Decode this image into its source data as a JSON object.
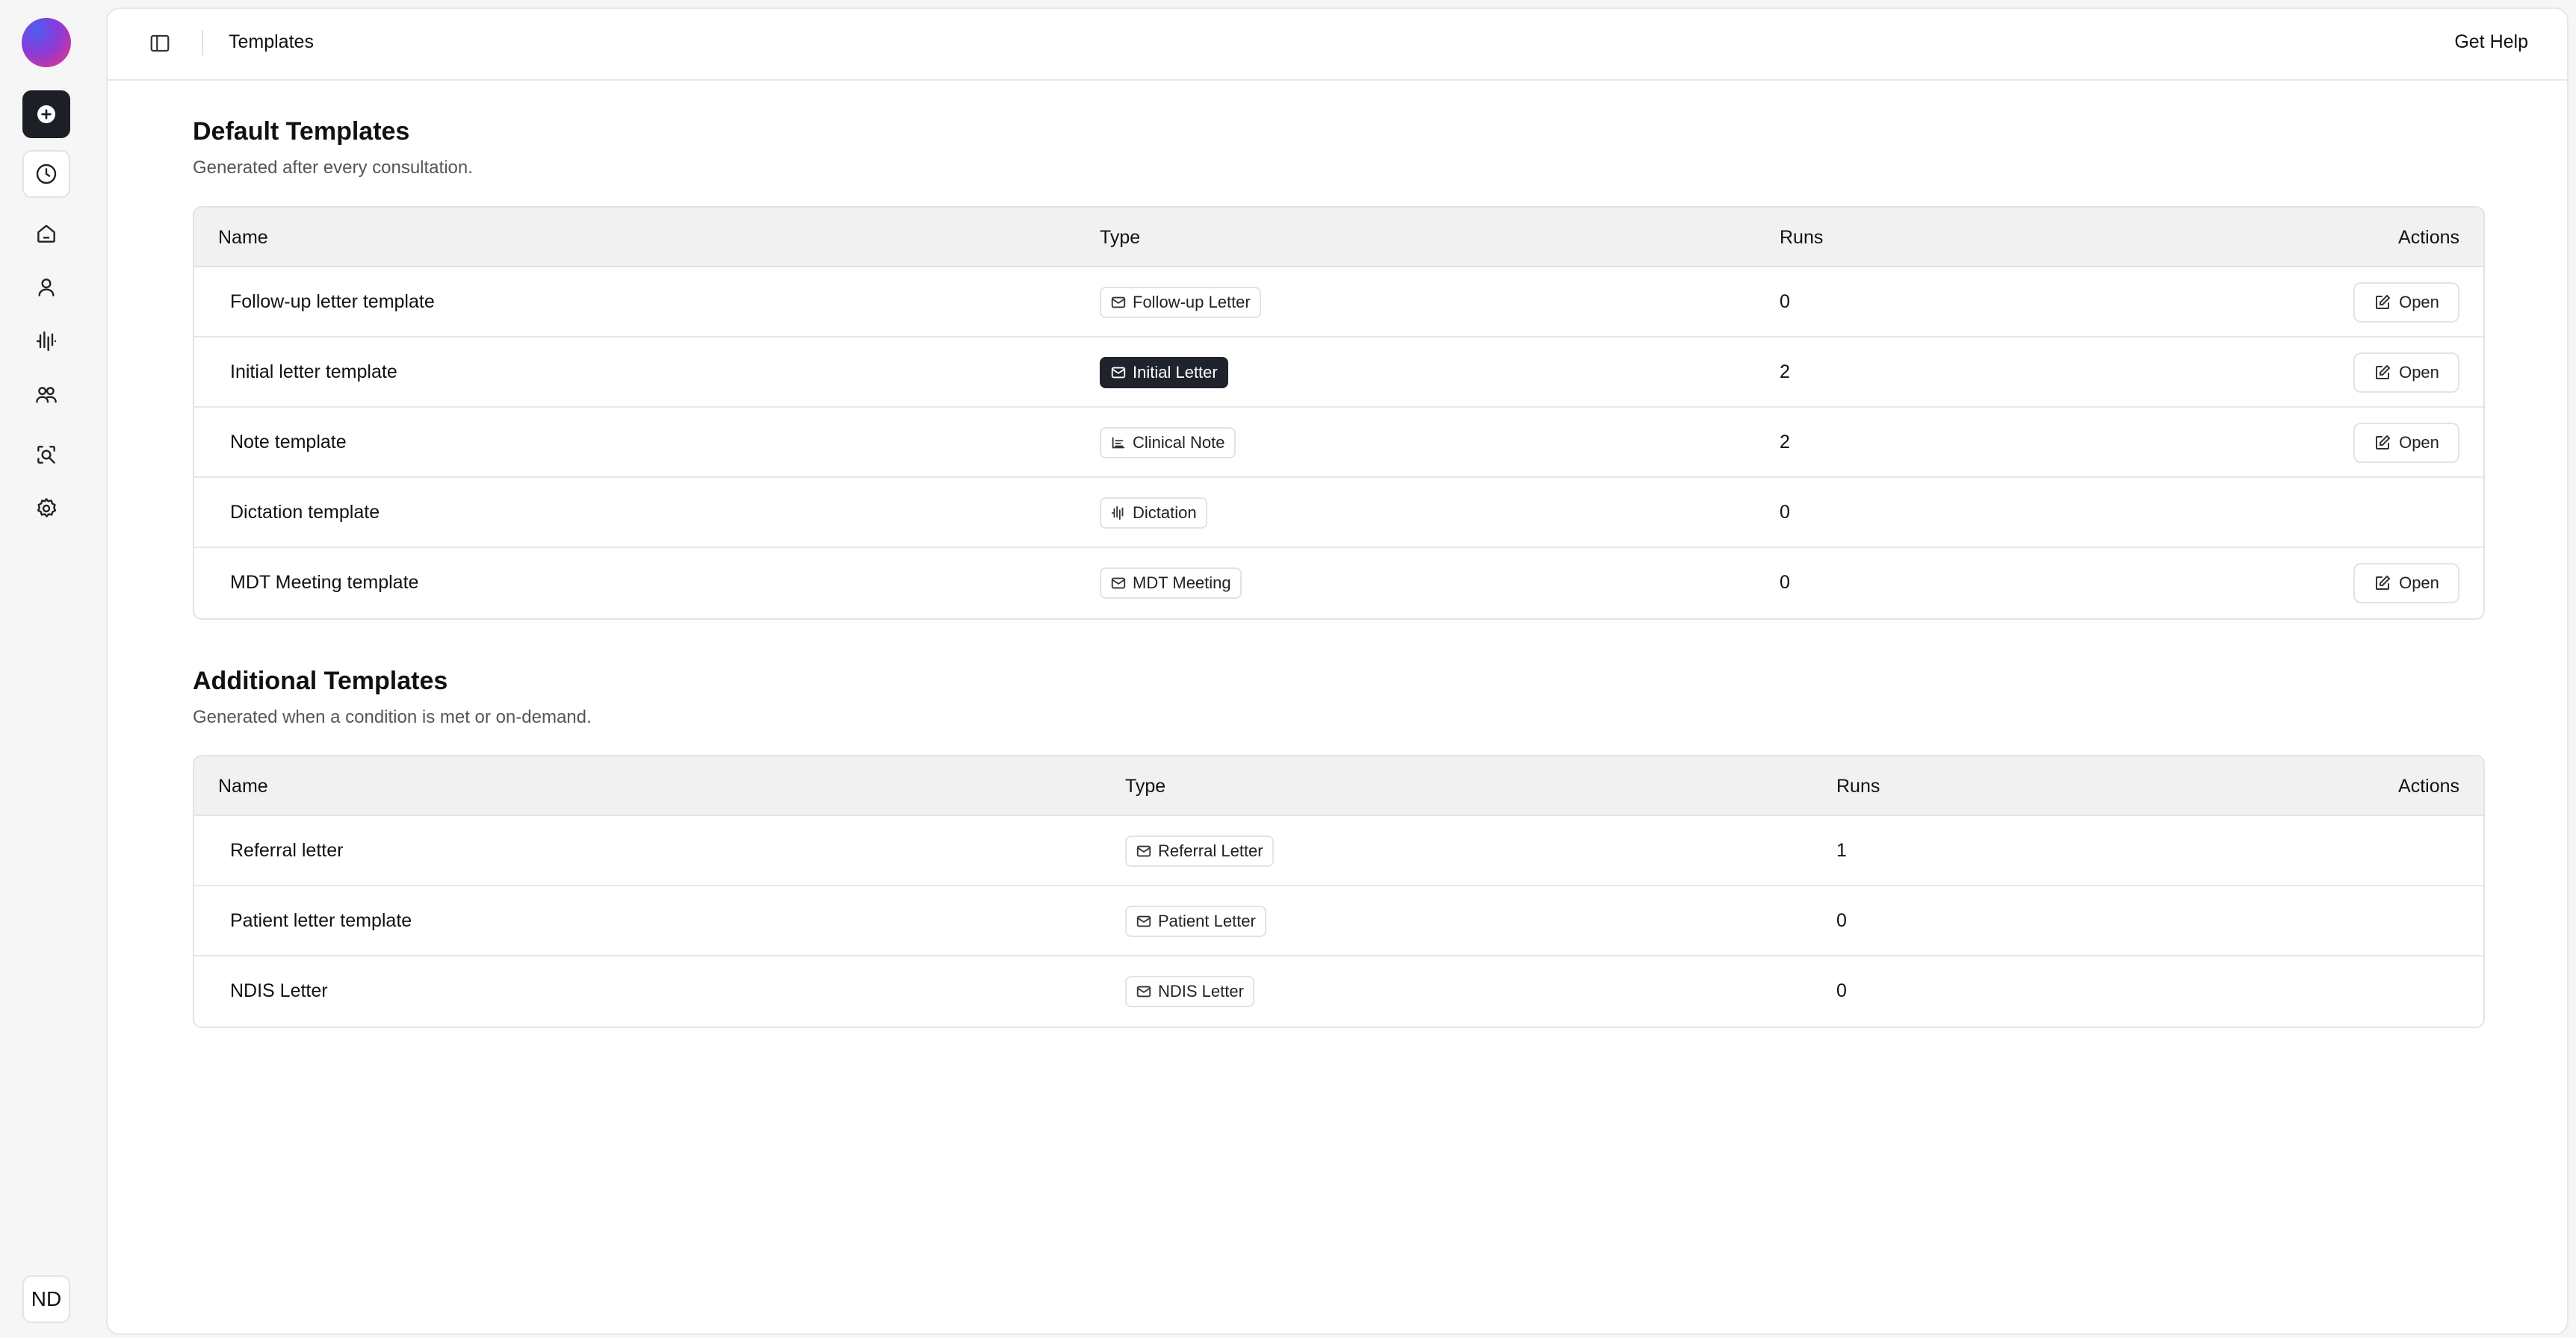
{
  "sidebar": {
    "items": [
      {
        "name": "new",
        "icon": "plus-circle-icon"
      },
      {
        "name": "history",
        "icon": "clock-icon"
      },
      {
        "name": "home",
        "icon": "home-icon"
      },
      {
        "name": "patients",
        "icon": "user-icon"
      },
      {
        "name": "dictation",
        "icon": "waveform-icon"
      },
      {
        "name": "team",
        "icon": "users-icon"
      },
      {
        "name": "search",
        "icon": "search-document-icon"
      },
      {
        "name": "settings",
        "icon": "gear-icon"
      }
    ],
    "avatar_initials": "ND"
  },
  "header": {
    "breadcrumb": "Templates",
    "help_label": "Get Help"
  },
  "default_section": {
    "title": "Default Templates",
    "subtitle": "Generated after every consultation.",
    "columns": {
      "name": "Name",
      "type": "Type",
      "runs": "Runs",
      "actions": "Actions"
    },
    "rows": [
      {
        "name": "Follow-up letter template",
        "type": "Follow-up Letter",
        "type_icon": "mail-icon",
        "runs": "0",
        "action": "Open"
      },
      {
        "name": "Initial letter template",
        "type": "Initial Letter",
        "type_icon": "mail-icon",
        "runs": "2",
        "action": "Open"
      },
      {
        "name": "Note template",
        "type": "Clinical Note",
        "type_icon": "text-lines-icon",
        "runs": "2",
        "action": "Open"
      },
      {
        "name": "Dictation template",
        "type": "Dictation",
        "type_icon": "waveform-icon",
        "runs": "0",
        "action": ""
      },
      {
        "name": "MDT Meeting template",
        "type": "MDT Meeting",
        "type_icon": "mail-icon",
        "runs": "0",
        "action": "Open"
      }
    ]
  },
  "additional_section": {
    "title": "Additional Templates",
    "subtitle": "Generated when a condition is met or on-demand.",
    "columns": {
      "name": "Name",
      "type": "Type",
      "runs": "Runs",
      "actions": "Actions"
    },
    "rows": [
      {
        "name": "Referral letter",
        "type": "Referral Letter",
        "type_icon": "mail-icon",
        "runs": "1"
      },
      {
        "name": "Patient letter template",
        "type": "Patient Letter",
        "type_icon": "mail-icon",
        "runs": "0"
      },
      {
        "name": "NDIS Letter",
        "type": "NDIS Letter",
        "type_icon": "mail-icon",
        "runs": "0"
      }
    ]
  },
  "colors": {
    "accent_dark": "#1f232b",
    "background": "#f6f6f7",
    "header_row": "#f1f1f2",
    "border": "#e3e3e6"
  }
}
